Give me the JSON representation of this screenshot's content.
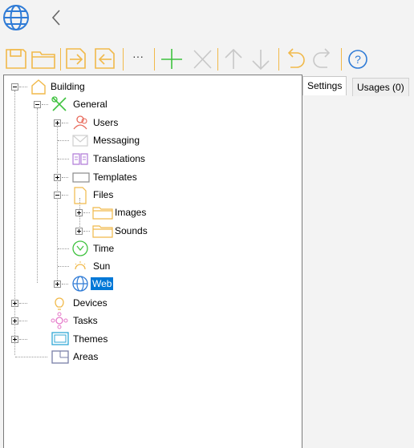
{
  "header": {
    "app_icon": "globe-icon",
    "back_icon": "chevron-left-icon"
  },
  "toolbar": {
    "icons": [
      "save-icon",
      "open-folder-icon",
      "import-icon",
      "export-icon",
      "more-icon",
      "add-icon",
      "delete-icon",
      "move-up-icon",
      "move-down-icon",
      "undo-icon",
      "redo-icon",
      "help-icon"
    ],
    "more_label": "···",
    "help_label": "?"
  },
  "tree": {
    "root": "Building",
    "general": "General",
    "users": "Users",
    "messaging": "Messaging",
    "translations": "Translations",
    "templates": "Templates",
    "files": "Files",
    "images": "Images",
    "sounds": "Sounds",
    "time": "Time",
    "sun": "Sun",
    "web": "Web",
    "devices": "Devices",
    "tasks": "Tasks",
    "themes": "Themes",
    "areas": "Areas"
  },
  "tabs": {
    "settings": "Settings",
    "usages": "Usages (0)"
  },
  "colors": {
    "accent": "#f1b94a",
    "selection": "#0078d7",
    "green": "#3fc23f",
    "blue": "#2f7bd6"
  }
}
